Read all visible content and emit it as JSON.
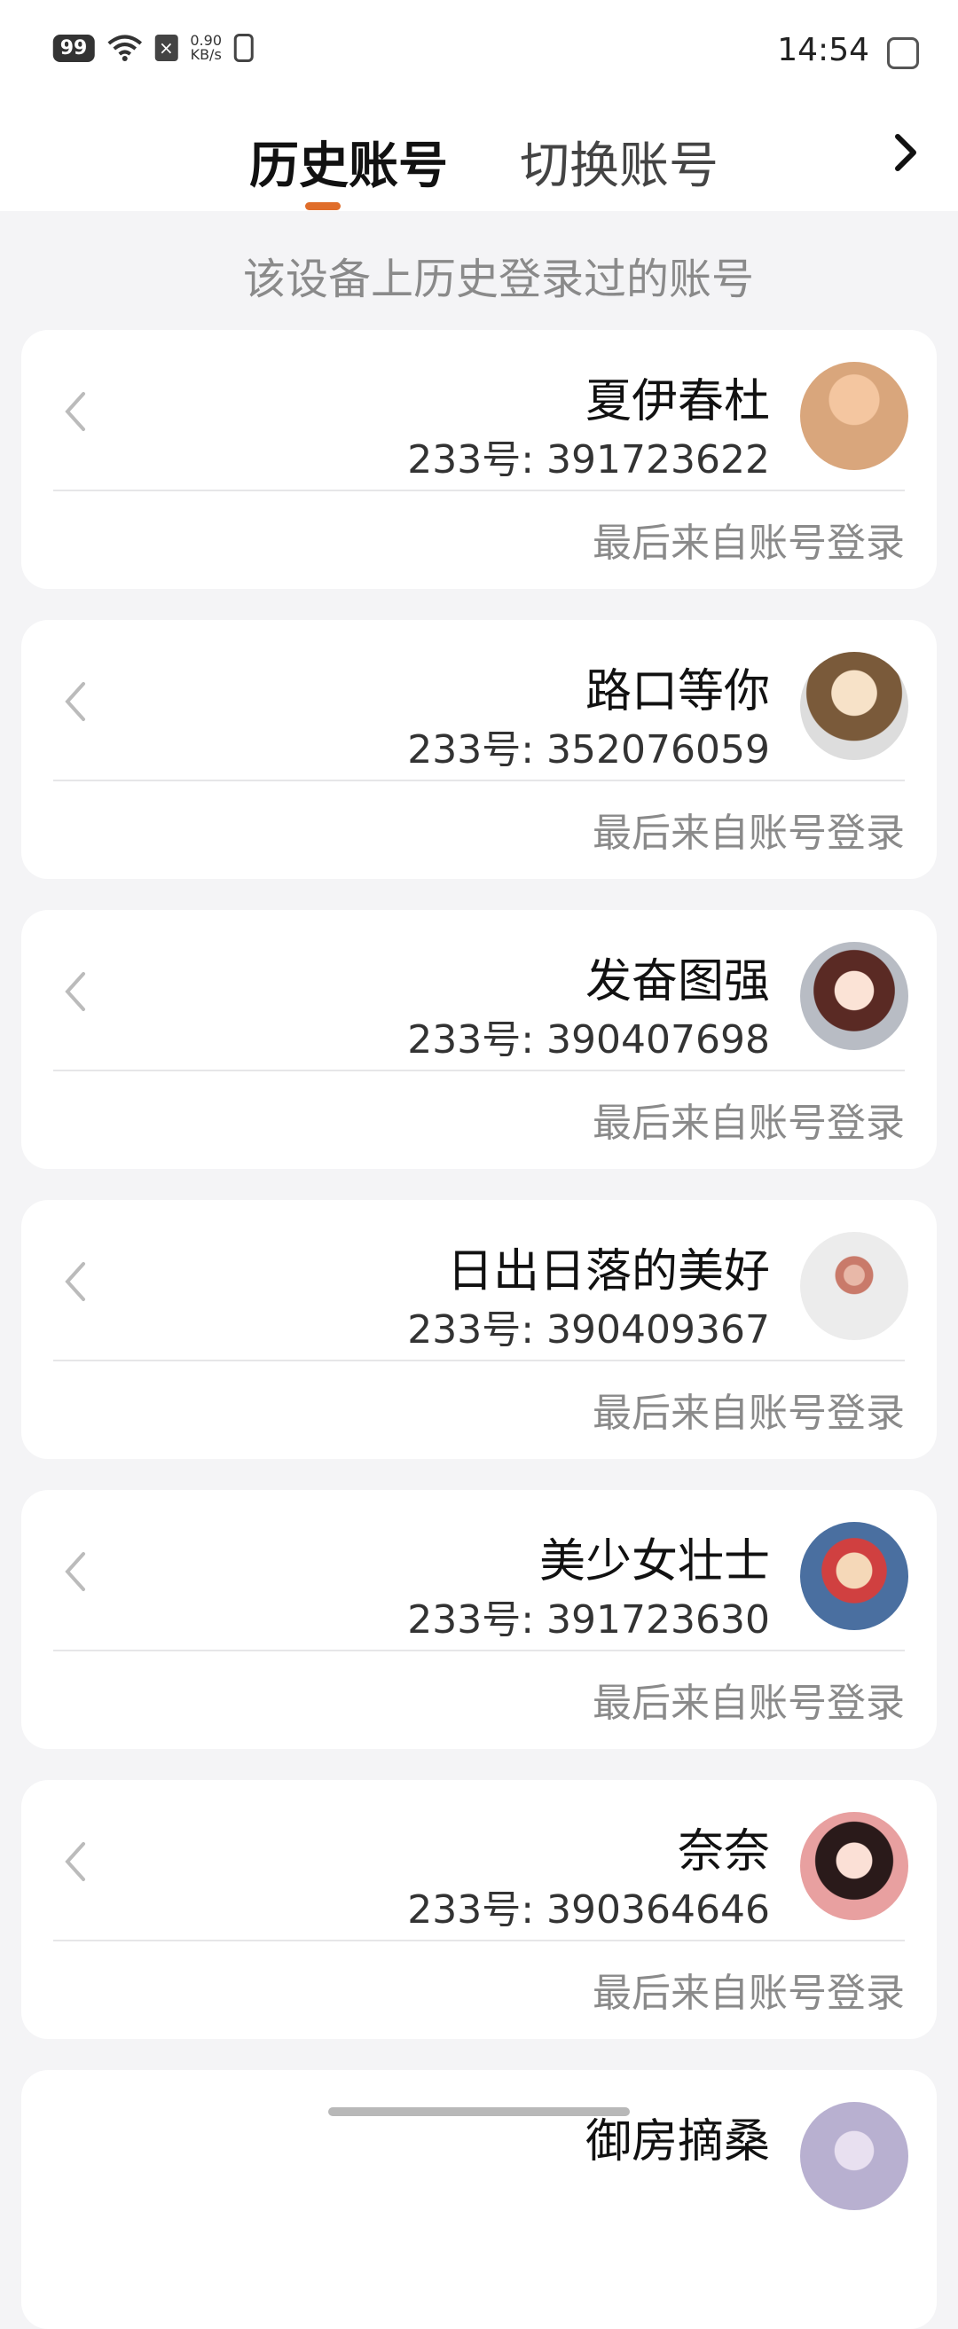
{
  "status_bar": {
    "time": "14:54",
    "battery": "99",
    "net_speed_top": "0.90",
    "net_speed_bottom": "KB/s"
  },
  "header": {
    "tab_history": "历史账号",
    "tab_switch": "切换账号"
  },
  "subtitle": "该设备上历史登录过的账号",
  "accounts": [
    {
      "name": "夏伊春杜",
      "uid": "233号: 391723622",
      "last_login": "最后来自账号登录"
    },
    {
      "name": "路口等你",
      "uid": "233号: 352076059",
      "last_login": "最后来自账号登录"
    },
    {
      "name": "发奋图强",
      "uid": "233号: 390407698",
      "last_login": "最后来自账号登录"
    },
    {
      "name": "日出日落的美好",
      "uid": "233号: 390409367",
      "last_login": "最后来自账号登录"
    },
    {
      "name": "美少女壮士",
      "uid": "233号: 391723630",
      "last_login": "最后来自账号登录"
    },
    {
      "name": "奈奈",
      "uid": "233号: 390364646",
      "last_login": "最后来自账号登录"
    },
    {
      "name": "御房摘桑",
      "uid": "",
      "last_login": ""
    }
  ],
  "colors": {
    "accent": "#e06d2a",
    "background": "#f4f4f6"
  }
}
